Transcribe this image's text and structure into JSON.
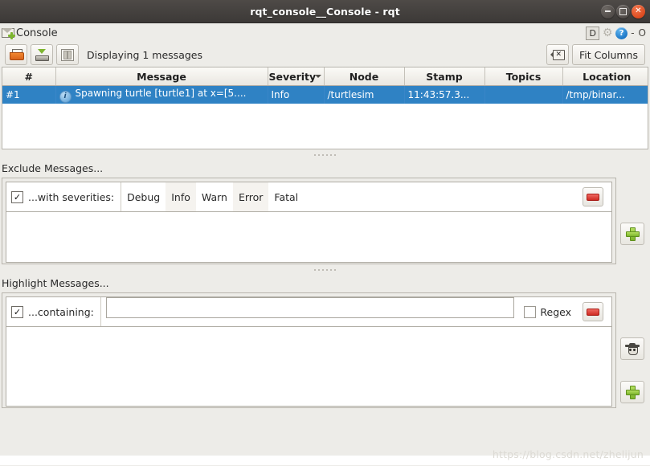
{
  "window": {
    "title": "rqt_console__Console - rqt",
    "buttons": {
      "minimize": "minimize",
      "maximize": "maximize",
      "close": "close"
    }
  },
  "dock": {
    "title": "Console",
    "icon": "envelope-add-icon",
    "controls": {
      "detach": "D",
      "settings": "gear-icon",
      "help": "?",
      "minimize": "-",
      "close": "O"
    }
  },
  "toolbar": {
    "open_label": "open-folder-icon",
    "save_label": "save-to-disk-icon",
    "pause_label": "pause-icon",
    "status": "Displaying 1 messages",
    "clear_label": "erase-icon",
    "fit_columns": "Fit Columns"
  },
  "table": {
    "columns": [
      "#",
      "Message",
      "Severity",
      "Node",
      "Stamp",
      "Topics",
      "Location"
    ],
    "sorted_column": "Severity",
    "sort_direction": "descending",
    "rows": [
      {
        "index": "#1",
        "message": "Spawning turtle [turtle1] at x=[5....",
        "message_icon": "info-icon",
        "severity": "Info",
        "node": "/turtlesim",
        "stamp": "11:43:57.3...",
        "topics": "",
        "location": "/tmp/binar...",
        "selected": true
      }
    ]
  },
  "exclude": {
    "section_label": "Exclude Messages...",
    "filter": {
      "enabled": true,
      "label": "...with severities:",
      "severities": [
        "Debug",
        "Info",
        "Warn",
        "Error",
        "Fatal"
      ],
      "remove_label": "remove-filter-button"
    },
    "add_label": "add-filter-button"
  },
  "highlight": {
    "section_label": "Highlight Messages...",
    "filter": {
      "enabled": true,
      "label": "...containing:",
      "value": "",
      "placeholder": "",
      "regex_label": "Regex",
      "regex_checked": false,
      "remove_label": "remove-filter-button"
    },
    "spy_label": "spy-icon",
    "add_label": "add-filter-button"
  },
  "watermark": "https://blog.csdn.net/zhelijun",
  "colors": {
    "titlebar": "#3c3937",
    "selection": "#2f82c4",
    "panel": "#edece8",
    "accent_green": "#7cb52c",
    "accent_red": "#cf2b22"
  }
}
